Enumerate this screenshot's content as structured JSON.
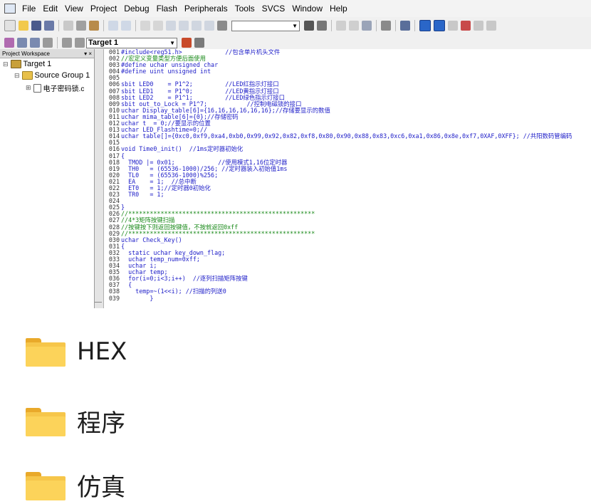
{
  "menu": [
    "File",
    "Edit",
    "View",
    "Project",
    "Debug",
    "Flash",
    "Peripherals",
    "Tools",
    "SVCS",
    "Window",
    "Help"
  ],
  "toolbar": {
    "target_select": "Target 1"
  },
  "project_panel": {
    "title": "Project Workspace",
    "close": "▾ ×",
    "items": [
      {
        "label": "Target 1",
        "expander": "⊟",
        "icon_color": "#c8a03a"
      },
      {
        "label": "Source Group 1",
        "expander": "⊟",
        "icon_color": "#e8c04a"
      },
      {
        "label": "电子密码锁.c",
        "expander": "⊞",
        "icon_color": "#ffffff"
      }
    ]
  },
  "editor": {
    "line_numbers": [
      "001",
      "002",
      "003",
      "004",
      "005",
      "006",
      "007",
      "008",
      "009",
      "010",
      "011",
      "012",
      "013",
      "014",
      "015",
      "016",
      "017",
      "018",
      "019",
      "020",
      "021",
      "022",
      "023",
      "024",
      "025",
      "026",
      "027",
      "028",
      "029",
      "030",
      "031",
      "032",
      "033",
      "034",
      "035",
      "036",
      "037",
      "038",
      "039"
    ],
    "lines": [
      "#include<reg51.h>            //包含单片机头文件",
      "//宏定义变量类型方便后面使用",
      "#define uchar unsigned char",
      "#define uint unsigned int",
      "",
      "sbit LED0    = P1^2;         //LED红指示灯接口",
      "sbit LED1    = P1^0;         //LED黄指示灯接口",
      "sbit LED2    = P1^1;         //LED绿色指示灯接口",
      "sbit out_to_Lock = P1^7;           //控制电磁锁的接口",
      "uchar Display_table[6]={16,16,16,16,16,16};//存储要显示的数值",
      "uchar mima_table[6]={0};//存储密码",
      "uchar t  = 0;//要显示的位置",
      "uchar LED_Flashtime=0;//",
      "uchar table[]={0xc0,0xf9,0xa4,0xb0,0x99,0x92,0x82,0xf8,0x80,0x90,0x88,0x83,0xc6,0xa1,0x86,0x8e,0xf7,0XAF,0XFF}; //共阳数码管编码",
      "",
      "void Time0_init()  //1ms定时器初始化",
      "{",
      "  TMOD |= 0x01;            //使用模式1,16位定时器",
      "  TH0   = (65536-1000)/256; //定时器装入初始值1ms",
      "  TL0   = (65536-1000)%256;",
      "  EA    = 1;  //总中断",
      "  ET0   = 1;//定时器0初始化",
      "  TR0   = 1;",
      "",
      "}",
      "//****************************************************",
      "//4*3矩阵按键扫描",
      "//按键按下则返回按键值，不按就返回0xff",
      "//****************************************************",
      "uchar Check_Key()",
      "{",
      "  static uchar key_down_flag;",
      "  uchar temp_num=0xff;",
      "  uchar i;",
      "  uchar temp;",
      "  for(i=0;i<3;i++)  //逐列扫描矩阵按键",
      "  {",
      "    temp=~(1<<i); //扫描的列送0",
      "        }"
    ],
    "comment_lines": [
      1,
      25,
      26,
      27,
      28
    ]
  },
  "folders": [
    {
      "label": "HEX",
      "color": "#f6c64a"
    },
    {
      "label": "程序",
      "color": "#f6c64a"
    },
    {
      "label": "仿真",
      "color": "#f6c64a"
    }
  ]
}
